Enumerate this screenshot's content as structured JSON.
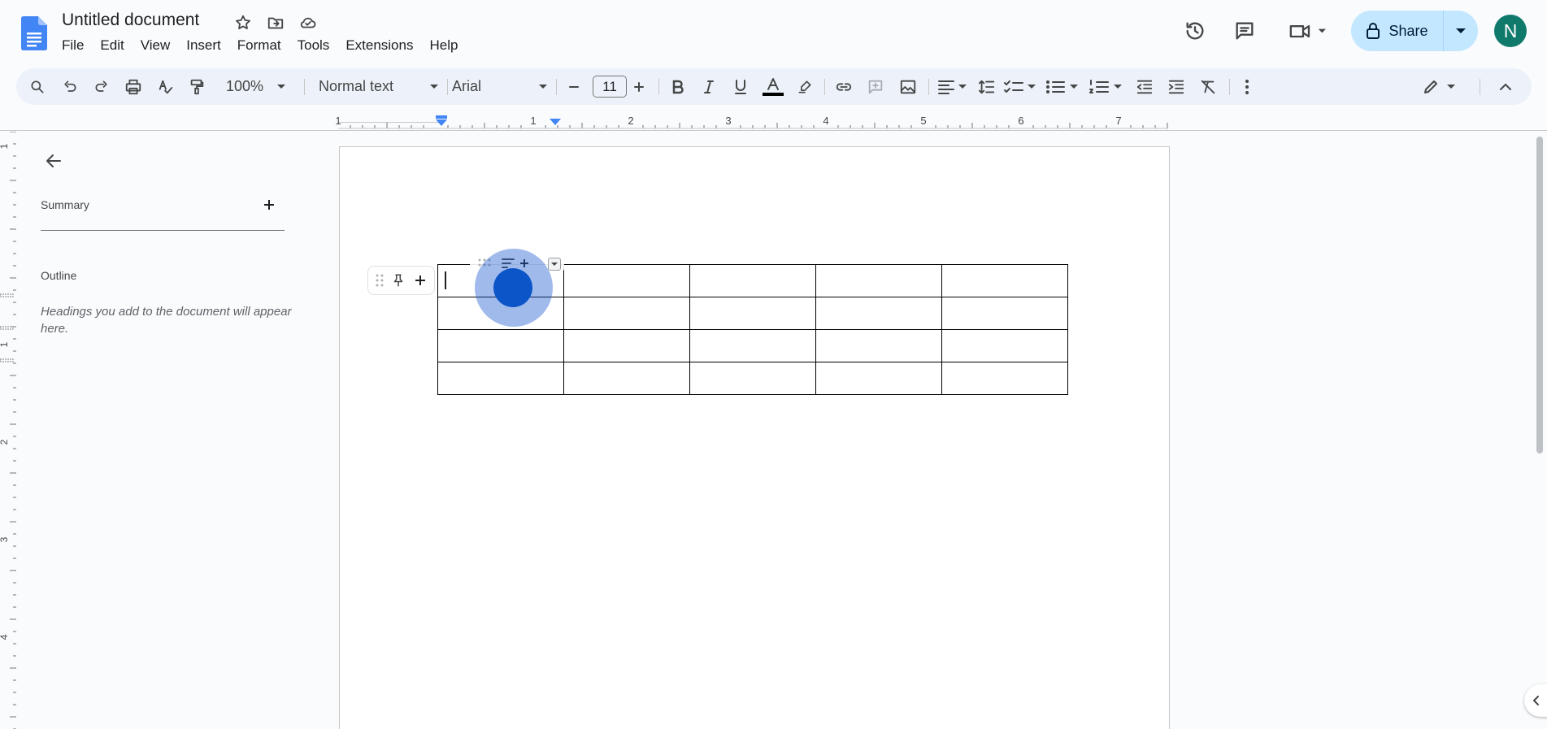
{
  "app": {
    "title": "Untitled document",
    "menu": [
      "File",
      "Edit",
      "View",
      "Insert",
      "Format",
      "Tools",
      "Extensions",
      "Help"
    ],
    "share_label": "Share",
    "avatar_initial": "N",
    "brand_color": "#4285f4",
    "share_bg": "#c2e7ff",
    "avatar_color": "#0f7a6c"
  },
  "toolbar": {
    "zoom": "100%",
    "style": "Normal text",
    "font": "Arial",
    "font_size": "11",
    "text_color": "#000000"
  },
  "ruler": {
    "top_numbers": [
      "1",
      "1",
      "2",
      "3",
      "4",
      "5",
      "6",
      "7"
    ],
    "left_numbers": [
      "1",
      "1",
      "2",
      "3",
      "4"
    ]
  },
  "outline": {
    "summary_label": "Summary",
    "outline_label": "Outline",
    "hint": "Headings you add to the document will appear here."
  },
  "table": {
    "rows": 4,
    "cols": 5
  }
}
